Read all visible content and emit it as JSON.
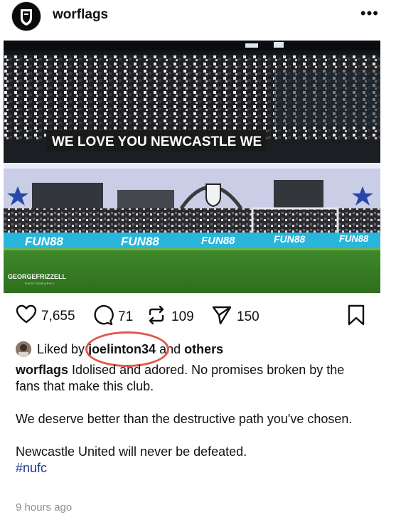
{
  "post": {
    "username": "worflags",
    "more_label": "•••",
    "image": {
      "banner_text": "WE LOVE YOU NEWCASTLE WE",
      "sponsor": "FUN88",
      "watermark_line1": "GEORGEFRIZZELL",
      "watermark_line2": "PHOTOGRAPHY"
    },
    "stats": {
      "likes": "7,655",
      "comments": "71",
      "reposts": "109",
      "shares": "150"
    },
    "liked_by": {
      "prefix": "Liked by",
      "user": "joelinton34",
      "and": "and",
      "others": "others"
    },
    "caption": {
      "author": "worflags",
      "line1": "Idolised and adored. No promises broken by the fans that make this club.",
      "line2": "We deserve better than the destructive path you've chosen.",
      "line3": "Newcastle United will never be defeated.",
      "hashtag": "#nufc"
    },
    "timestamp": "9 hours ago"
  }
}
